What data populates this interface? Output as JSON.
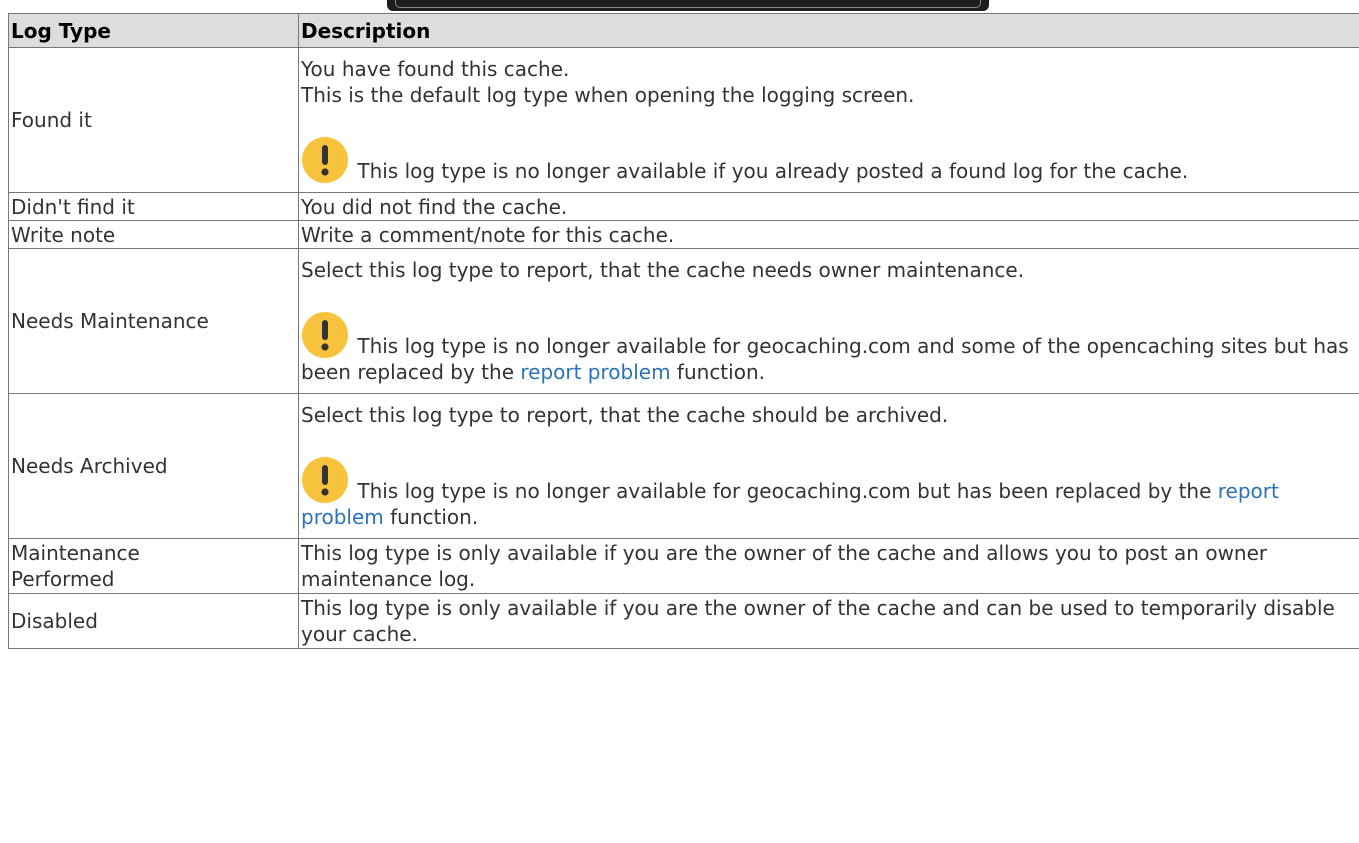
{
  "table": {
    "headers": [
      "Log Type",
      "Description"
    ],
    "rows": [
      {
        "type": "Found it",
        "lines": [
          "You have found this cache.",
          "This is the default log type when opening the logging screen."
        ],
        "note": {
          "text": "This log type is no longer available if you already posted a found log for the cache."
        }
      },
      {
        "type": "Didn't find it",
        "lines": [
          "You did not find the cache."
        ]
      },
      {
        "type": "Write note",
        "lines": [
          "Write a comment/note for this cache."
        ]
      },
      {
        "type": "Needs Maintenance",
        "lines": [
          "Select this log type to report, that the cache needs owner maintenance."
        ],
        "note": {
          "text_before": "This log type is no longer available for geocaching.com and some of the opencaching sites but has been replaced by the",
          "link": "report problem",
          "text_after": "function."
        }
      },
      {
        "type": "Needs Archived",
        "lines": [
          "Select this log type to report, that the cache should be archived."
        ],
        "note": {
          "text_before": "This log type is no longer available for geocaching.com but has been replaced by the",
          "link": "report problem",
          "text_after": "function."
        }
      },
      {
        "type": "Maintenance Performed",
        "lines": [
          "This log type is only available if you are the owner of the cache and allows you to post an owner maintenance log."
        ]
      },
      {
        "type": "Disabled",
        "lines": [
          "This log type is only available if you are the owner of the cache and can be used to temporarily disable your cache."
        ]
      }
    ]
  },
  "icons": {
    "note": "exclamation-warning-icon"
  },
  "colors": {
    "header_bg": "#dddddd",
    "border": "#777777",
    "link": "#2b73b7",
    "warning_icon": "#f8c33c"
  }
}
